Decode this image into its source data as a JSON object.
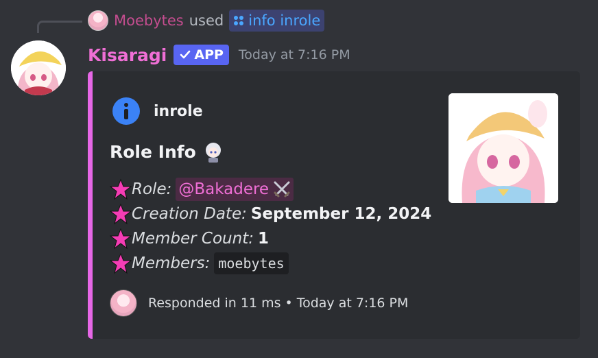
{
  "reply": {
    "username": "Moebytes",
    "used_text": "used",
    "command": "info inrole"
  },
  "message": {
    "author": "Kisaragi",
    "badge": "APP",
    "timestamp": "Today at 7:16 PM"
  },
  "embed": {
    "accent_color": "#e667e6",
    "author_name": "inrole",
    "title": "Role Info",
    "fields": [
      {
        "label": "Role:",
        "mention": "@Bakadere"
      },
      {
        "label": "Creation Date:",
        "value": "September 12, 2024"
      },
      {
        "label": "Member Count:",
        "value": "1"
      },
      {
        "label": "Members:",
        "code": "moebytes"
      }
    ],
    "footer": {
      "text": "Responded in 11 ms",
      "separator": "•",
      "timestamp": "Today at 7:16 PM"
    }
  },
  "icons": {
    "command": "slash-command-icon",
    "author": "info-icon",
    "bullet": "star-icon",
    "role": "crossed-swords-icon",
    "badge": "checkmark-icon"
  }
}
